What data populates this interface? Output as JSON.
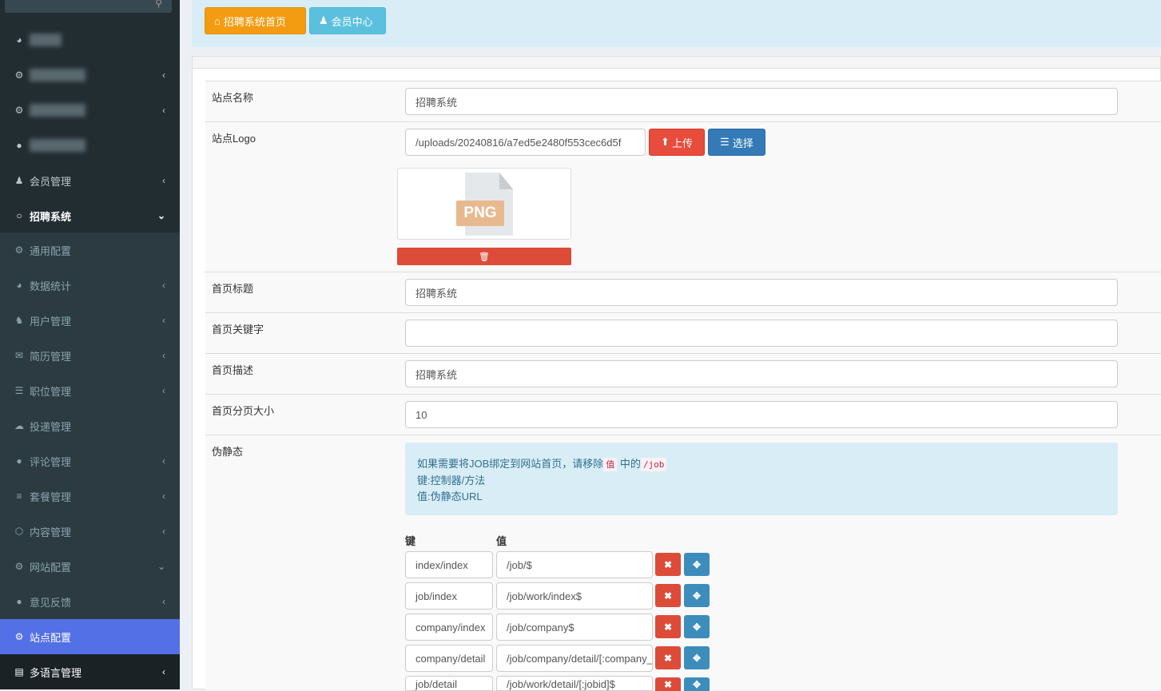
{
  "sidebar": {
    "items": [
      {
        "label": "会员管理",
        "icon": "user-icon",
        "arrow": "‹"
      },
      {
        "label": "招聘系统",
        "icon": "circle-icon",
        "arrow": "⌄"
      },
      {
        "label": "通用配置",
        "icon": "gear-icon",
        "arrow": ""
      },
      {
        "label": "数据统计",
        "icon": "dashboard-icon",
        "arrow": "‹"
      },
      {
        "label": "用户管理",
        "icon": "users-icon",
        "arrow": "‹"
      },
      {
        "label": "简历管理",
        "icon": "envelope-icon",
        "arrow": "‹"
      },
      {
        "label": "职位管理",
        "icon": "align-center-icon",
        "arrow": "‹"
      },
      {
        "label": "投递管理",
        "icon": "cloud-upload-icon",
        "arrow": ""
      },
      {
        "label": "评论管理",
        "icon": "comment-icon",
        "arrow": "‹"
      },
      {
        "label": "套餐管理",
        "icon": "list-icon",
        "arrow": "‹"
      },
      {
        "label": "内容管理",
        "icon": "gem-icon",
        "arrow": "‹"
      },
      {
        "label": "网站配置",
        "icon": "cogs-icon",
        "arrow": "⌄"
      },
      {
        "label": "意见反馈",
        "icon": "comments-icon",
        "arrow": "‹"
      },
      {
        "label": "站点配置",
        "icon": "cogs-icon",
        "arrow": ""
      },
      {
        "label": "多语言管理",
        "icon": "book-icon",
        "arrow": "‹"
      }
    ]
  },
  "topbar": {
    "home_label": "招聘系统首页",
    "member_label": "会员中心"
  },
  "form": {
    "site_name": {
      "label": "站点名称",
      "value": "招聘系统"
    },
    "site_logo": {
      "label": "站点Logo",
      "value": "/uploads/20240816/a7ed5e2480f553cec6d5f",
      "upload": "上传",
      "select": "选择",
      "file_type": "PNG"
    },
    "home_title": {
      "label": "首页标题",
      "value": "招聘系统"
    },
    "home_keywords": {
      "label": "首页关键字",
      "value": ""
    },
    "home_desc": {
      "label": "首页描述",
      "value": "招聘系统"
    },
    "page_size": {
      "label": "首页分页大小",
      "value": "10"
    },
    "rewrite": {
      "label": "伪静态",
      "tip_pre": "如果需要将JOB绑定到网站首页，请移除",
      "tip_code1": "值",
      "tip_mid": "中的",
      "tip_code2": "/job",
      "tip_line2": "键:控制器/方法",
      "tip_line3": "值:伪静态URL",
      "key_header": "键",
      "val_header": "值",
      "rows": [
        {
          "key": "index/index",
          "value": "/job/$"
        },
        {
          "key": "job/index",
          "value": "/job/work/index$"
        },
        {
          "key": "company/index",
          "value": "/job/company$"
        },
        {
          "key": "company/detail",
          "value": "/job/company/detail/[:company_id]$"
        },
        {
          "key": "job/detail",
          "value": "/job/work/detail/[:jobid]$"
        }
      ]
    }
  }
}
